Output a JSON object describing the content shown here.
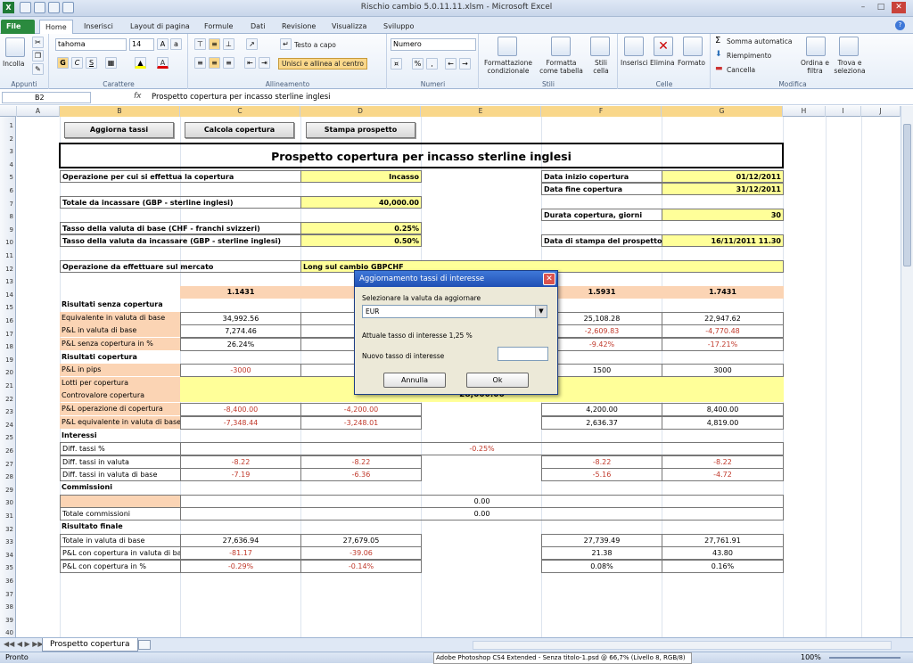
{
  "window": {
    "title": "Rischio cambio 5.0.11.11.xlsm  -  Microsoft Excel"
  },
  "tabs": [
    "File",
    "Home",
    "Inserisci",
    "Layout di pagina",
    "Formule",
    "Dati",
    "Revisione",
    "Visualizza",
    "Sviluppo"
  ],
  "ribbon": {
    "groups": [
      "Appunti",
      "Carattere",
      "Allineamento",
      "Numeri",
      "Stili",
      "Celle",
      "Modifica"
    ],
    "paste": "Incolla",
    "font_name": "tahoma",
    "font_size": "14",
    "bold": "G",
    "italic": "C",
    "underline": "S",
    "wrap_text": "Testo a capo",
    "merge_center": "Unisci e allinea al centro",
    "number_format": "Numero",
    "cond_format": "Formattazione condizionale",
    "format_table": "Formatta come tabella",
    "cell_styles": "Stili cella",
    "insert": "Inserisci",
    "delete": "Elimina",
    "format": "Formato",
    "autosum": "Somma automatica",
    "fill": "Riempimento",
    "clear": "Cancella",
    "sort_filter": "Ordina e filtra",
    "find_select": "Trova e seleziona"
  },
  "formula_bar": {
    "name_box": "B2",
    "fx": "fx",
    "formula": "Prospetto copertura per incasso sterline inglesi"
  },
  "columns": [
    "A",
    "B",
    "C",
    "D",
    "E",
    "F",
    "G",
    "H",
    "I",
    "J"
  ],
  "sheet": {
    "buttons": [
      "Aggiorna tassi",
      "Calcola copertura",
      "Stampa prospetto"
    ],
    "title": "Prospetto copertura per incasso sterline inglesi",
    "op_label": "Operazione per cui si effettua  la copertura",
    "op_value": "Incasso",
    "total_label": "Totale da incassare (GBP - sterline inglesi)",
    "total_value": "40,000.00",
    "rate_base_label": "Tasso della valuta di base (CHF - franchi svizzeri)",
    "rate_base_value": "0.25%",
    "rate_gbp_label": "Tasso della valuta da incassare (GBP - sterline inglesi)",
    "rate_gbp_value": "0.50%",
    "date_start_label": "Data inizio copertura",
    "date_start_value": "01/12/2011",
    "date_end_label": "Data fine copertura",
    "date_end_value": "31/12/2011",
    "duration_label": "Durata copertura, giorni",
    "duration_value": "30",
    "print_date_label": "Data di stampa del prospetto",
    "print_date_value": "16/11/2011 11.30",
    "market_label": "Operazione da effettuare sul mercato",
    "market_value": "Long sul cambio GBPCHF",
    "rates": [
      "1.1431",
      "1.",
      "",
      "1.5931",
      "1.7431"
    ],
    "sec_no_cover": "Risultati senza copertura",
    "r14": {
      "label": "Equivalente in valuta di base",
      "vals": [
        "34,992.56",
        "30,",
        "",
        "25,108.28",
        "22,947.62"
      ]
    },
    "r15": {
      "label": "P&L in valuta di base",
      "vals": [
        "7,274.46",
        "3,2",
        "",
        "-2,609.83",
        "-4,770.48"
      ]
    },
    "r16": {
      "label": "P&L senza copertura in %",
      "vals": [
        "26.24%",
        "1",
        "",
        "-9.42%",
        "-17.21%"
      ]
    },
    "sec_cover": "Risultati copertura",
    "r18": {
      "label": "P&L in pips",
      "vals": [
        "-3000",
        "",
        "",
        "1500",
        "3000"
      ]
    },
    "r19": {
      "label": "Lotti per copertura"
    },
    "r20": {
      "label": "Controvalore copertura",
      "value": "28,000.00"
    },
    "r21": {
      "label": "P&L operazione di copertura",
      "vals": [
        "-8,400.00",
        "-4,200.00",
        "",
        "4,200.00",
        "8,400.00"
      ]
    },
    "r22": {
      "label": "P&L equivalente in valuta di base",
      "vals": [
        "-7,348.44",
        "-3,248.01",
        "",
        "2,636.37",
        "4,819.00"
      ]
    },
    "sec_interest": "Interessi",
    "r24": {
      "label": "Diff. tassi %",
      "value": "-0.25%"
    },
    "r25": {
      "label": "Diff. tassi in valuta",
      "vals": [
        "-8.22",
        "-8.22",
        "",
        "-8.22",
        "-8.22"
      ]
    },
    "r26": {
      "label": "Diff. tassi in valuta di base",
      "vals": [
        "-7.19",
        "-6.36",
        "",
        "-5.16",
        "-4.72"
      ]
    },
    "sec_comm": "Commissioni",
    "r28": {
      "value": "0.00"
    },
    "r29": {
      "label": "Totale commissioni",
      "value": "0.00"
    },
    "sec_final": "Risultato finale",
    "r31": {
      "label": "Totale in valuta di base",
      "vals": [
        "27,636.94",
        "27,679.05",
        "",
        "27,739.49",
        "27,761.91"
      ]
    },
    "r32": {
      "label": "P&L con copertura in valuta di base",
      "vals": [
        "-81.17",
        "-39.06",
        "",
        "21.38",
        "43.80"
      ]
    },
    "r33": {
      "label": "P&L con copertura in %",
      "vals": [
        "-0.29%",
        "-0.14%",
        "",
        "0.08%",
        "0.16%"
      ]
    }
  },
  "dialog": {
    "title": "Aggiornamento tassi di interesse",
    "select_label": "Selezionare la valuta da aggiornare",
    "select_value": "EUR",
    "current_rate": "Attuale tasso di interesse 1,25 %",
    "new_rate_label": "Nuovo tasso di interesse",
    "new_rate_value": "",
    "cancel": "Annulla",
    "ok": "Ok"
  },
  "sheet_tab": "Prospetto copertura",
  "status": {
    "ready": "Pronto",
    "taskbar": "Adobe Photoshop CS4 Extended - Senza titolo-1.psd @ 66,7% (Livello 8, RGB/8)",
    "zoom": "100%"
  }
}
